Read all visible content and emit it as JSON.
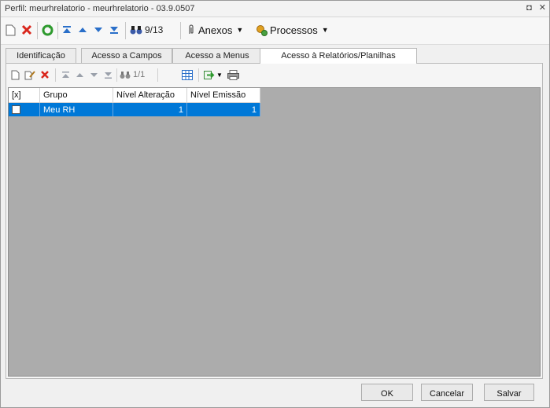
{
  "window": {
    "title": "Perfil: meurhrelatorio - meurhrelatorio - 03.9.0507",
    "restore_glyph": "◘",
    "close_glyph": "✕"
  },
  "toolbar": {
    "record_counter": "9/13",
    "anexos_label": "Anexos",
    "processos_label": "Processos"
  },
  "tabs": [
    {
      "label": "Identificação",
      "active": false
    },
    {
      "label": "Acesso a Campos",
      "active": false
    },
    {
      "label": "Acesso a Menus",
      "active": false
    },
    {
      "label": "Acesso à Relatórios/Planilhas",
      "active": true
    }
  ],
  "grid_toolbar": {
    "record_counter": "1/1"
  },
  "grid": {
    "columns": [
      "[x]",
      "Grupo",
      "Nível Alteração",
      "Nível Emissão"
    ],
    "rows": [
      {
        "checked": false,
        "grupo": "Meu RH",
        "nivel_alteracao": "1",
        "nivel_emissao": "1",
        "selected": true
      }
    ]
  },
  "footer": {
    "ok_label": "OK",
    "cancel_label": "Cancelar",
    "save_label": "Salvar"
  },
  "colors": {
    "selection": "#0078d7",
    "grid_background": "#acacac",
    "delete_red": "#d9261c",
    "nav_blue": "#2a6fc9",
    "refresh_green": "#2e9a2e"
  }
}
